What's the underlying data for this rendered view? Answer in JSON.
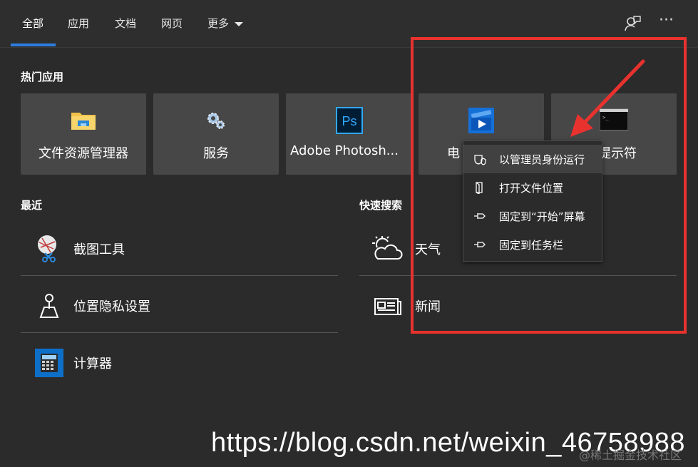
{
  "tabs": [
    {
      "label": "全部"
    },
    {
      "label": "应用"
    },
    {
      "label": "文档"
    },
    {
      "label": "网页"
    },
    {
      "label": "更多"
    }
  ],
  "top_icons": [
    "feedback-icon",
    "more-options-icon"
  ],
  "more_options_glyph": "···",
  "sections": {
    "popular": "热门应用",
    "recent": "最近",
    "quick_search": "快速搜索"
  },
  "popular_apps": [
    {
      "label": "文件资源管理器",
      "icon": "folder-icon"
    },
    {
      "label": "服务",
      "icon": "gears-icon"
    },
    {
      "label": "Adobe Photosh...",
      "icon": "photoshop-icon",
      "icon_text": "Ps"
    },
    {
      "label": "电",
      "icon": "movies-tv-icon"
    },
    {
      "label": "提示符",
      "icon": "command-prompt-icon"
    }
  ],
  "recent": [
    {
      "label": "截图工具",
      "icon": "snipping-tool-icon"
    },
    {
      "label": "位置隐私设置",
      "icon": "location-pin-icon"
    },
    {
      "label": "计算器",
      "icon": "calculator-icon"
    }
  ],
  "quick_search": [
    {
      "label": "天气",
      "icon": "weather-icon"
    },
    {
      "label": "新闻",
      "icon": "news-icon"
    }
  ],
  "context_menu": [
    {
      "label": "以管理员身份运行",
      "icon": "shield-icon",
      "highlighted": true
    },
    {
      "label": "打开文件位置",
      "icon": "open-file-location-icon"
    },
    {
      "label": "固定到“开始”屏幕",
      "icon": "pin-icon"
    },
    {
      "label": "固定到任务栏",
      "icon": "pin-icon"
    }
  ],
  "colors": {
    "accent": "#2d7de0",
    "background": "#2b2b2b",
    "tile": "#474747",
    "annotation_red": "#e8322e"
  },
  "watermark": "https://blog.csdn.net/weixin_46758988",
  "watermark_small": "@稀土掘金技术社区"
}
